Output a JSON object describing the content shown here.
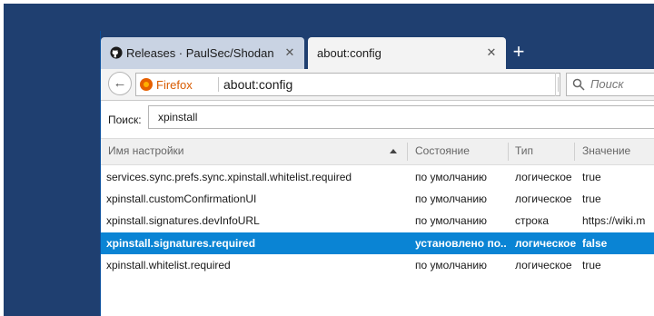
{
  "tabs": [
    {
      "title": "Releases · PaulSec/Shodan",
      "close": "✕"
    },
    {
      "title": "about:config",
      "close": "✕"
    }
  ],
  "new_tab": "+",
  "nav": {
    "back": "←",
    "identity": "Firefox",
    "url": "about:config",
    "reload": "↻",
    "search_placeholder": "Поиск"
  },
  "filter": {
    "label": "Поиск:",
    "value": "xpinstall"
  },
  "table": {
    "headers": [
      "Имя настройки",
      "Состояние",
      "Тип",
      "Значение"
    ],
    "rows": [
      {
        "name": "services.sync.prefs.sync.xpinstall.whitelist.required",
        "status": "по умолчанию",
        "type": "логическое",
        "value": "true"
      },
      {
        "name": "xpinstall.customConfirmationUI",
        "status": "по умолчанию",
        "type": "логическое",
        "value": "true"
      },
      {
        "name": "xpinstall.signatures.devInfoURL",
        "status": "по умолчанию",
        "type": "строка",
        "value": "https://wiki.m"
      },
      {
        "name": "xpinstall.signatures.required",
        "status": "установлено по...",
        "type": "логическое",
        "value": "false"
      },
      {
        "name": "xpinstall.whitelist.required",
        "status": "по умолчанию",
        "type": "логическое",
        "value": "true"
      }
    ]
  }
}
